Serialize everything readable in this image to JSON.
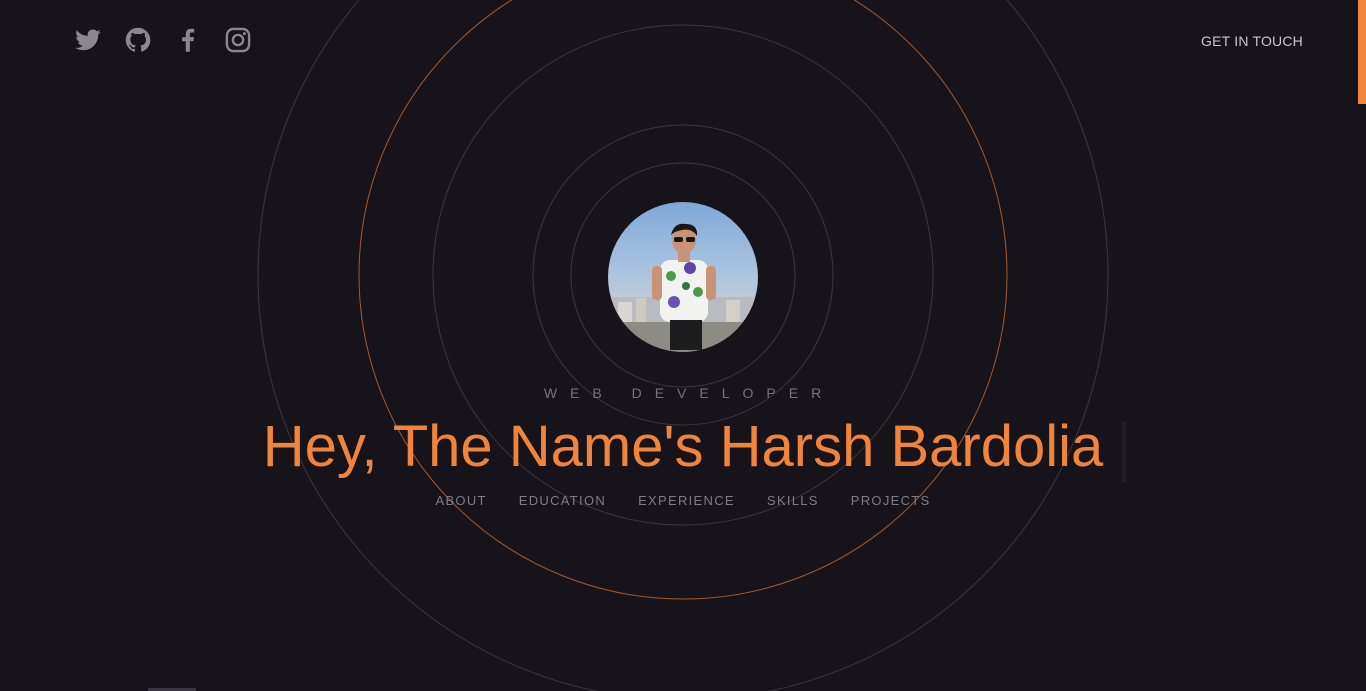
{
  "header": {
    "social_links": [
      {
        "name": "Twitter",
        "icon": "twitter-icon"
      },
      {
        "name": "GitHub",
        "icon": "github-icon"
      },
      {
        "name": "Facebook",
        "icon": "facebook-icon"
      },
      {
        "name": "Instagram",
        "icon": "instagram-icon"
      }
    ],
    "cta_label": "GET IN TOUCH"
  },
  "hero": {
    "role": "WEB DEVELOPER",
    "headline": "Hey, The Name's Harsh Bardolia",
    "nav": [
      "ABOUT",
      "EDUCATION",
      "EXPERIENCE",
      "SKILLS",
      "PROJECTS"
    ]
  },
  "colors": {
    "background": "#17131a",
    "accent": "#f0843a",
    "muted_text": "#7f7c85",
    "ring": "#3a3640"
  }
}
